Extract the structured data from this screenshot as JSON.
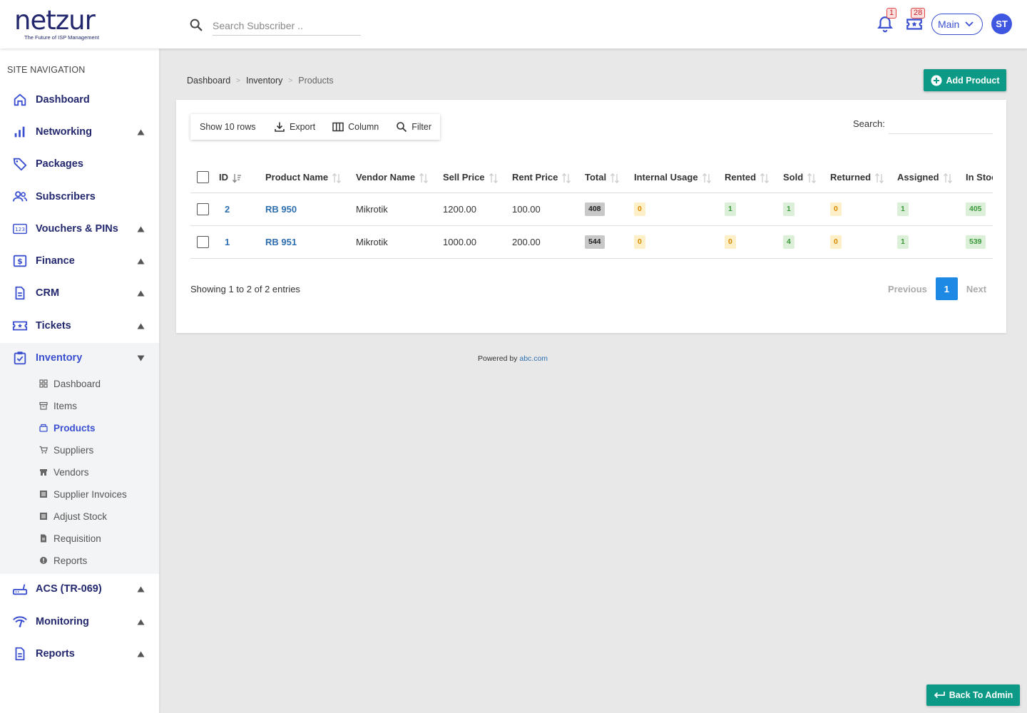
{
  "brand": {
    "name": "netzur",
    "tagline": "The Future of ISP Management"
  },
  "search": {
    "placeholder": "Search Subscriber .."
  },
  "header": {
    "notifications_count": "1",
    "tickets_count": "28",
    "select_label": "Main",
    "avatar": "ST"
  },
  "sidebar": {
    "title": "SITE NAVIGATION",
    "items": [
      {
        "label": "Dashboard"
      },
      {
        "label": "Networking"
      },
      {
        "label": "Packages"
      },
      {
        "label": "Subscribers"
      },
      {
        "label": "Vouchers & PINs"
      },
      {
        "label": "Finance"
      },
      {
        "label": "CRM"
      },
      {
        "label": "Tickets"
      },
      {
        "label": "Inventory"
      },
      {
        "label": "ACS (TR-069)"
      },
      {
        "label": "Monitoring"
      },
      {
        "label": "Reports"
      }
    ],
    "inventory_sub": [
      {
        "label": "Dashboard"
      },
      {
        "label": "Items"
      },
      {
        "label": "Products"
      },
      {
        "label": "Suppliers"
      },
      {
        "label": "Vendors"
      },
      {
        "label": "Supplier Invoices"
      },
      {
        "label": "Adjust Stock"
      },
      {
        "label": "Requisition"
      },
      {
        "label": "Reports"
      }
    ]
  },
  "breadcrumb": {
    "items": [
      "Dashboard",
      "Inventory",
      "Products"
    ],
    "sep": ">"
  },
  "actions": {
    "add_product": "Add Product",
    "back_to_admin": "Back To Admin"
  },
  "toolbar": {
    "show_rows": "Show 10 rows",
    "export": "Export",
    "column": "Column",
    "filter": "Filter",
    "search_label": "Search:"
  },
  "table": {
    "headers": [
      "ID",
      "Product Name",
      "Vendor Name",
      "Sell Price",
      "Rent Price",
      "Total",
      "Internal Usage",
      "Rented",
      "Sold",
      "Returned",
      "Assigned",
      "In Stock"
    ],
    "rows": [
      {
        "id": "2",
        "name": "RB 950",
        "vendor": "Mikrotik",
        "sell": "1200.00",
        "rent": "100.00",
        "total": "408",
        "internal": "0",
        "rented": "1",
        "sold": "1",
        "returned": "0",
        "assigned": "1",
        "stock": "405"
      },
      {
        "id": "1",
        "name": "RB 951",
        "vendor": "Mikrotik",
        "sell": "1000.00",
        "rent": "200.00",
        "total": "544",
        "internal": "0",
        "rented": "0",
        "sold": "4",
        "returned": "0",
        "assigned": "1",
        "stock": "539"
      }
    ]
  },
  "footer_info": {
    "showing": "Showing 1 to 2 of 2 entries"
  },
  "pagination": {
    "previous": "Previous",
    "page": "1",
    "next": "Next"
  },
  "powered": {
    "text": "Powered by",
    "link": "abc.com"
  },
  "colors": {
    "primary": "#23286e",
    "accent": "#3a4fd0",
    "teal": "#0c9a86",
    "link": "#2f6fb0"
  }
}
